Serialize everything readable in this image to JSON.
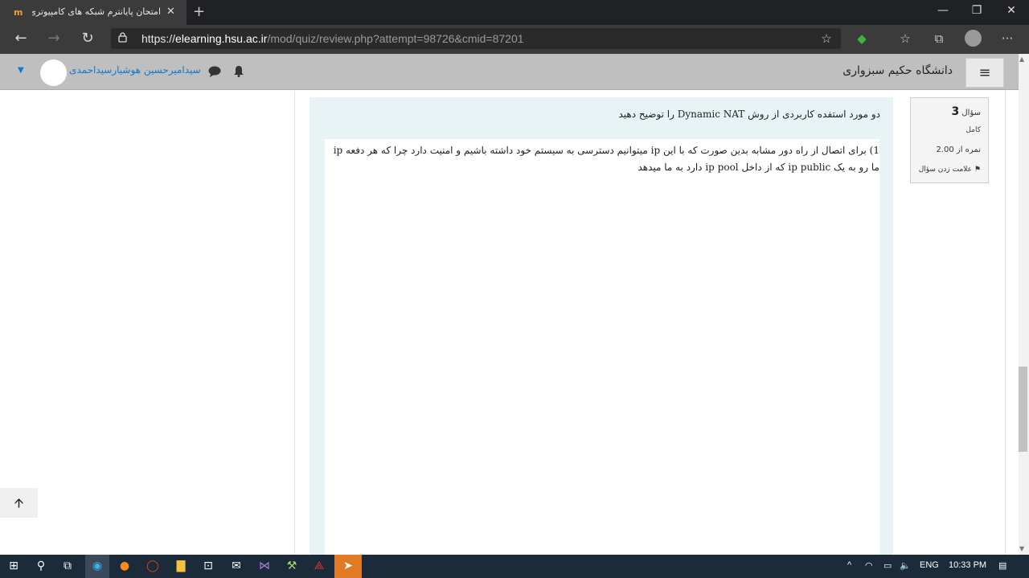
{
  "browser": {
    "tab_title": "امتحان پایانترم شبکه های کامپیوتری",
    "tab_favicon": "m",
    "url_scheme": "https://",
    "url_host": "elearning.hsu.ac.ir",
    "url_path": "/mod/quiz/review.php?attempt=98726&cmid=87201",
    "new_tab": "+",
    "close_tab": "✕",
    "window_min": "—",
    "window_max": "❐",
    "window_close": "✕",
    "more": "···"
  },
  "header": {
    "site_name": "دانشگاه حکیم سبزواری",
    "user_name": "سیدامیرحسین هوشیارسیداحمدی",
    "hamburger": "≡"
  },
  "question_info": {
    "label": "سؤال",
    "number": "3",
    "state": "کامل",
    "grade": "نمره از 2.00",
    "flag": "علامت زدن سؤال"
  },
  "question": {
    "text": "دو مورد استفده کاربردی از  روش Dynamic NAT را توضیح دهید",
    "answer": "1) برای اتصال از راه دور مشابه بدین صورت که با این ip میتوانیم دسترسی به سیستم خود داشته باشیم و امنیت دارد چرا که هر دفعه ip ما رو به یک ip public که از داخل ip pool دارد به ما میدهد"
  },
  "ui": {
    "back_to_top": "🡩"
  },
  "taskbar": {
    "lang": "ENG",
    "time": "10:33 PM"
  }
}
